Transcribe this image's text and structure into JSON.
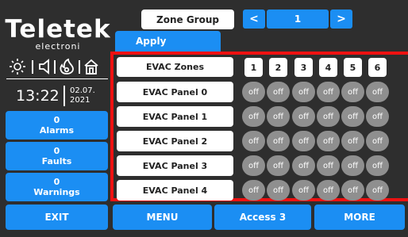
{
  "logo": {
    "title": "Teletek",
    "subtitle": "electroni"
  },
  "status": {
    "icons": [
      "sun-icon",
      "speaker-icon",
      "fire-icon",
      "home-icon"
    ]
  },
  "clock": {
    "time": "13:22",
    "date_line1": "02.07.",
    "date_line2": "2021"
  },
  "sidebar": {
    "alarms": {
      "count": "0",
      "label": "Alarms"
    },
    "faults": {
      "count": "0",
      "label": "Faults"
    },
    "warnings": {
      "count": "0",
      "label": "Warnings"
    },
    "exit_label": "EXIT"
  },
  "header": {
    "zone_group_label": "Zone Group",
    "apply_label": "Apply",
    "prev_symbol": "<",
    "page_number": "1",
    "next_symbol": ">"
  },
  "grid": {
    "header_label": "EVAC Zones",
    "zones": [
      "1",
      "2",
      "3",
      "4",
      "5",
      "6"
    ],
    "rows": [
      {
        "label": "EVAC Panel 0",
        "cells": [
          "off",
          "off",
          "off",
          "off",
          "off",
          "off"
        ]
      },
      {
        "label": "EVAC Panel 1",
        "cells": [
          "off",
          "off",
          "off",
          "off",
          "off",
          "off"
        ]
      },
      {
        "label": "EVAC Panel 2",
        "cells": [
          "off",
          "off",
          "off",
          "off",
          "off",
          "off"
        ]
      },
      {
        "label": "EVAC Panel 3",
        "cells": [
          "off",
          "off",
          "off",
          "off",
          "off",
          "off"
        ]
      },
      {
        "label": "EVAC Panel 4",
        "cells": [
          "off",
          "off",
          "off",
          "off",
          "off",
          "off"
        ]
      }
    ]
  },
  "bottom_bar": {
    "menu_label": "MENU",
    "access_label": "Access 3",
    "more_label": "MORE"
  },
  "colors": {
    "accent": "#1b8ef3",
    "background": "#2e2e2e",
    "highlight_border": "#ee1111",
    "cell_off": "#8f8f8f"
  }
}
